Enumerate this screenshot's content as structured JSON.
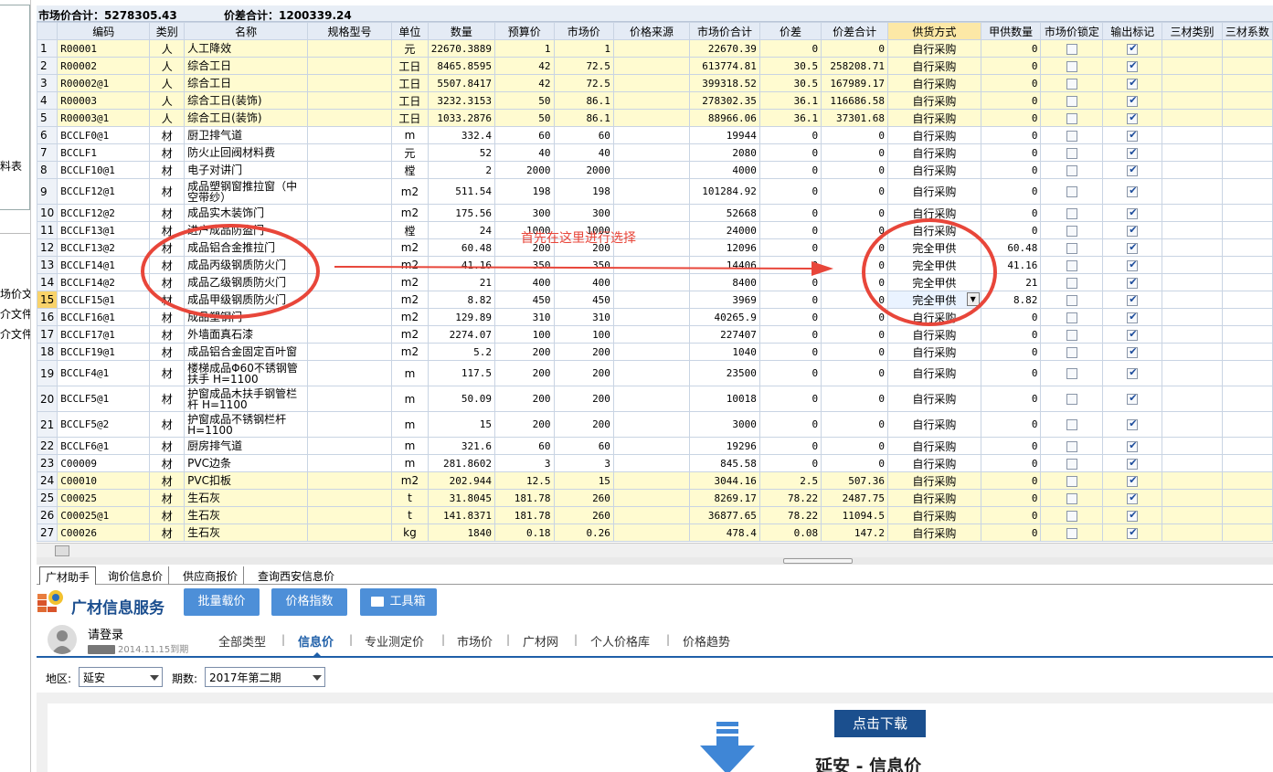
{
  "left_panel": {
    "labels": [
      "料表",
      "场价文",
      "介文件",
      "介文件"
    ]
  },
  "summary": {
    "market_total": "市场价合计：5278305.43",
    "diff_total": "价差合计：1200339.24"
  },
  "headers": [
    "",
    "编码",
    "类别",
    "名称",
    "规格型号",
    "单位",
    "数量",
    "预算价",
    "市场价",
    "价格来源",
    "市场价合计",
    "价差",
    "价差合计",
    "供货方式",
    "甲供数量",
    "市场价锁定",
    "输出标记",
    "三材类别",
    "三材系数"
  ],
  "rows": [
    {
      "no": "1",
      "code": "R00001",
      "cat": "人",
      "name": "人工降效",
      "unit": "元",
      "qty": "22670.3889",
      "budget": "1",
      "market": "1",
      "total": "22670.39",
      "diff": "0",
      "diff_total": "0",
      "supply": "自行采购",
      "jia_qty": "0"
    },
    {
      "no": "2",
      "code": "R00002",
      "cat": "人",
      "name": "综合工日",
      "unit": "工日",
      "qty": "8465.8595",
      "budget": "42",
      "market": "72.5",
      "total": "613774.81",
      "diff": "30.5",
      "diff_total": "258208.71",
      "supply": "自行采购",
      "jia_qty": "0"
    },
    {
      "no": "3",
      "code": "R00002@1",
      "cat": "人",
      "name": "综合工日",
      "unit": "工日",
      "qty": "5507.8417",
      "budget": "42",
      "market": "72.5",
      "total": "399318.52",
      "diff": "30.5",
      "diff_total": "167989.17",
      "supply": "自行采购",
      "jia_qty": "0"
    },
    {
      "no": "4",
      "code": "R00003",
      "cat": "人",
      "name": "综合工日(装饰)",
      "unit": "工日",
      "qty": "3232.3153",
      "budget": "50",
      "market": "86.1",
      "total": "278302.35",
      "diff": "36.1",
      "diff_total": "116686.58",
      "supply": "自行采购",
      "jia_qty": "0"
    },
    {
      "no": "5",
      "code": "R00003@1",
      "cat": "人",
      "name": "综合工日(装饰)",
      "unit": "工日",
      "qty": "1033.2876",
      "budget": "50",
      "market": "86.1",
      "total": "88966.06",
      "diff": "36.1",
      "diff_total": "37301.68",
      "supply": "自行采购",
      "jia_qty": "0"
    },
    {
      "no": "6",
      "code": "BCCLF0@1",
      "cat": "材",
      "name": "厨卫排气道",
      "unit": "m",
      "qty": "332.4",
      "budget": "60",
      "market": "60",
      "total": "19944",
      "diff": "0",
      "diff_total": "0",
      "supply": "自行采购",
      "jia_qty": "0"
    },
    {
      "no": "7",
      "code": "BCCLF1",
      "cat": "材",
      "name": "防火止回阀材料费",
      "unit": "元",
      "qty": "52",
      "budget": "40",
      "market": "40",
      "total": "2080",
      "diff": "0",
      "diff_total": "0",
      "supply": "自行采购",
      "jia_qty": "0"
    },
    {
      "no": "8",
      "code": "BCCLF10@1",
      "cat": "材",
      "name": "电子对讲门",
      "unit": "樘",
      "qty": "2",
      "budget": "2000",
      "market": "2000",
      "total": "4000",
      "diff": "0",
      "diff_total": "0",
      "supply": "自行采购",
      "jia_qty": "0"
    },
    {
      "no": "9",
      "code": "BCCLF12@1",
      "cat": "材",
      "name": "成品塑钢窗推拉窗（中空带纱）",
      "unit": "m2",
      "qty": "511.54",
      "budget": "198",
      "market": "198",
      "total": "101284.92",
      "diff": "0",
      "diff_total": "0",
      "supply": "自行采购",
      "jia_qty": "0"
    },
    {
      "no": "10",
      "code": "BCCLF12@2",
      "cat": "材",
      "name": "成品实木装饰门",
      "unit": "m2",
      "qty": "175.56",
      "budget": "300",
      "market": "300",
      "total": "52668",
      "diff": "0",
      "diff_total": "0",
      "supply": "自行采购",
      "jia_qty": "0"
    },
    {
      "no": "11",
      "code": "BCCLF13@1",
      "cat": "材",
      "name": "进户成品防盗门",
      "unit": "樘",
      "qty": "24",
      "budget": "1000",
      "market": "1000",
      "total": "24000",
      "diff": "0",
      "diff_total": "0",
      "supply": "自行采购",
      "jia_qty": "0"
    },
    {
      "no": "12",
      "code": "BCCLF13@2",
      "cat": "材",
      "name": "成品铝合金推拉门",
      "unit": "m2",
      "qty": "60.48",
      "budget": "200",
      "market": "200",
      "total": "12096",
      "diff": "0",
      "diff_total": "0",
      "supply": "完全甲供",
      "jia_qty": "60.48"
    },
    {
      "no": "13",
      "code": "BCCLF14@1",
      "cat": "材",
      "name": "成品丙级钢质防火门",
      "unit": "m2",
      "qty": "41.16",
      "budget": "350",
      "market": "350",
      "total": "14406",
      "diff": "0",
      "diff_total": "0",
      "supply": "完全甲供",
      "jia_qty": "41.16"
    },
    {
      "no": "14",
      "code": "BCCLF14@2",
      "cat": "材",
      "name": "成品乙级钢质防火门",
      "unit": "m2",
      "qty": "21",
      "budget": "400",
      "market": "400",
      "total": "8400",
      "diff": "0",
      "diff_total": "0",
      "supply": "完全甲供",
      "jia_qty": "21"
    },
    {
      "no": "15",
      "code": "BCCLF15@1",
      "cat": "材",
      "name": "成品甲级钢质防火门",
      "unit": "m2",
      "qty": "8.82",
      "budget": "450",
      "market": "450",
      "total": "3969",
      "diff": "0",
      "diff_total": "0",
      "supply": "完全甲供",
      "jia_qty": "8.82"
    },
    {
      "no": "16",
      "code": "BCCLF16@1",
      "cat": "材",
      "name": "成品塑钢门",
      "unit": "m2",
      "qty": "129.89",
      "budget": "310",
      "market": "310",
      "total": "40265.9",
      "diff": "0",
      "diff_total": "0",
      "supply": "自行采购",
      "jia_qty": "0"
    },
    {
      "no": "17",
      "code": "BCCLF17@1",
      "cat": "材",
      "name": "外墙面真石漆",
      "unit": "m2",
      "qty": "2274.07",
      "budget": "100",
      "market": "100",
      "total": "227407",
      "diff": "0",
      "diff_total": "0",
      "supply": "自行采购",
      "jia_qty": "0"
    },
    {
      "no": "18",
      "code": "BCCLF19@1",
      "cat": "材",
      "name": "成品铝合金固定百叶窗",
      "unit": "m2",
      "qty": "5.2",
      "budget": "200",
      "market": "200",
      "total": "1040",
      "diff": "0",
      "diff_total": "0",
      "supply": "自行采购",
      "jia_qty": "0"
    },
    {
      "no": "19",
      "code": "BCCLF4@1",
      "cat": "材",
      "name": "楼梯成品Φ60不锈钢管扶手 H=1100",
      "unit": "m",
      "qty": "117.5",
      "budget": "200",
      "market": "200",
      "total": "23500",
      "diff": "0",
      "diff_total": "0",
      "supply": "自行采购",
      "jia_qty": "0"
    },
    {
      "no": "20",
      "code": "BCCLF5@1",
      "cat": "材",
      "name": "护窗成品木扶手钢管栏杆 H=1100",
      "unit": "m",
      "qty": "50.09",
      "budget": "200",
      "market": "200",
      "total": "10018",
      "diff": "0",
      "diff_total": "0",
      "supply": "自行采购",
      "jia_qty": "0"
    },
    {
      "no": "21",
      "code": "BCCLF5@2",
      "cat": "材",
      "name": "护窗成品不锈钢栏杆 H=1100",
      "unit": "m",
      "qty": "15",
      "budget": "200",
      "market": "200",
      "total": "3000",
      "diff": "0",
      "diff_total": "0",
      "supply": "自行采购",
      "jia_qty": "0"
    },
    {
      "no": "22",
      "code": "BCCLF6@1",
      "cat": "材",
      "name": "厨房排气道",
      "unit": "m",
      "qty": "321.6",
      "budget": "60",
      "market": "60",
      "total": "19296",
      "diff": "0",
      "diff_total": "0",
      "supply": "自行采购",
      "jia_qty": "0"
    },
    {
      "no": "23",
      "code": "C00009",
      "cat": "材",
      "name": "PVC边条",
      "unit": "m",
      "qty": "281.8602",
      "budget": "3",
      "market": "3",
      "total": "845.58",
      "diff": "0",
      "diff_total": "0",
      "supply": "自行采购",
      "jia_qty": "0"
    },
    {
      "no": "24",
      "code": "C00010",
      "cat": "材",
      "name": "PVC扣板",
      "unit": "m2",
      "qty": "202.944",
      "budget": "12.5",
      "market": "15",
      "total": "3044.16",
      "diff": "2.5",
      "diff_total": "507.36",
      "supply": "自行采购",
      "jia_qty": "0"
    },
    {
      "no": "25",
      "code": "C00025",
      "cat": "材",
      "name": "生石灰",
      "unit": "t",
      "qty": "31.8045",
      "budget": "181.78",
      "market": "260",
      "total": "8269.17",
      "diff": "78.22",
      "diff_total": "2487.75",
      "supply": "自行采购",
      "jia_qty": "0"
    },
    {
      "no": "26",
      "code": "C00025@1",
      "cat": "材",
      "name": "生石灰",
      "unit": "t",
      "qty": "141.8371",
      "budget": "181.78",
      "market": "260",
      "total": "36877.65",
      "diff": "78.22",
      "diff_total": "11094.5",
      "supply": "自行采购",
      "jia_qty": "0"
    },
    {
      "no": "27",
      "code": "C00026",
      "cat": "材",
      "name": "生石灰",
      "unit": "kg",
      "qty": "1840",
      "budget": "0.18",
      "market": "0.26",
      "total": "478.4",
      "diff": "0.08",
      "diff_total": "147.2",
      "supply": "自行采购",
      "jia_qty": "0"
    }
  ],
  "annotation": {
    "text": "首先在这里进行选择",
    "color": "#e8463a"
  },
  "bottom_tabs": [
    "广材助手",
    "询价信息价",
    "供应商报价",
    "查询西安信息价"
  ],
  "service": {
    "title": "广材信息服务",
    "buttons": [
      "批量载价",
      "价格指数",
      "工具箱"
    ],
    "login": "请登录",
    "expire": "2014.11.15到期",
    "nav": [
      "全部类型",
      "信息价",
      "专业测定价",
      "市场价",
      "广材网",
      "个人价格库",
      "价格趋势"
    ]
  },
  "filter": {
    "region_label": "地区:",
    "region_value": "延安",
    "period_label": "期数:",
    "period_value": "2017年第二期"
  },
  "content": {
    "download_label": "点击下载",
    "region_title": "延安 - 信息价"
  },
  "colors": {
    "accent": "#1f5fa8",
    "header_highlight": "#fce8a6",
    "row_highlight": "#fffbd0"
  }
}
